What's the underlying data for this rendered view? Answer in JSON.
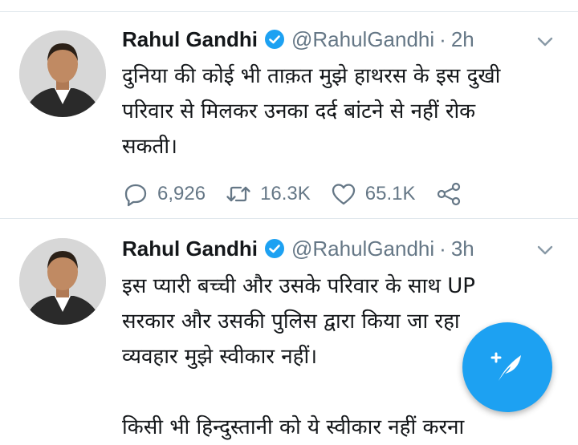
{
  "tweets": [
    {
      "author": "Rahul Gandhi",
      "handle": "@RahulGandhi",
      "separator": "·",
      "time": "2h",
      "lines": [
        "दुनिया की कोई भी ताक़त मुझे हाथरस के इस दुखी",
        "परिवार से मिलकर उनका दर्द बांटने से नहीं रोक",
        "सकती।"
      ],
      "replies": "6,926",
      "retweets": "16.3K",
      "likes": "65.1K"
    },
    {
      "author": "Rahul Gandhi",
      "handle": "@RahulGandhi",
      "separator": "·",
      "time": "3h",
      "lines": [
        "इस प्यारी बच्ची और उसके परिवार के साथ UP",
        "सरकार और उसकी पुलिस द्वारा किया जा रहा",
        "व्यवहार मुझे स्वीकार नहीं।",
        "",
        "किसी भी हिन्दुस्तानी को ये स्वीकार नहीं करना"
      ]
    }
  ],
  "colors": {
    "accent": "#1da1f2",
    "text": "#14171a",
    "muted": "#657786",
    "divider": "#e1e8ed"
  },
  "icons": [
    "verified-badge-icon",
    "chevron-down-icon",
    "reply-icon",
    "retweet-icon",
    "like-icon",
    "share-icon",
    "compose-feather-icon"
  ]
}
